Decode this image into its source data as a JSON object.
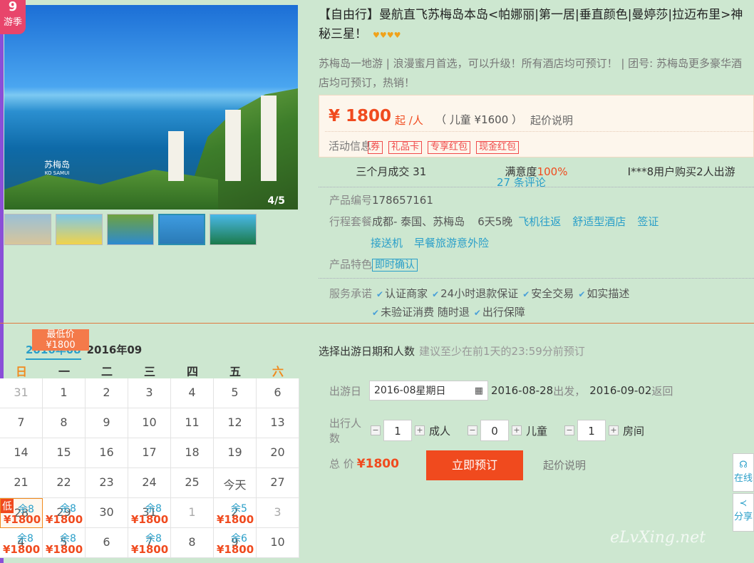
{
  "badge": {
    "top": "9",
    "bottom": "游季"
  },
  "gallery": {
    "location": "苏梅岛",
    "location_sub": "KO SAMUI",
    "counter": "4/5",
    "thumbs": [
      "thumb-1",
      "thumb-2",
      "thumb-3",
      "thumb-4",
      "thumb-5"
    ],
    "active_thumb": 4
  },
  "product": {
    "title": "【自由行】曼航直飞苏梅岛本岛<帕娜丽|第一居|垂直颜色|曼婷莎|拉迈布里>神秘三星！",
    "stars": "♥♥♥♥",
    "subtitle": "苏梅岛一地游 | 浪漫蜜月首选，可以升级！所有酒店均可预订！ | 团号: 苏梅岛更多豪华酒店均可预订，热销！"
  },
  "price": {
    "amount": "¥ 1800",
    "unit": "起 /人",
    "child": "（ 儿童 ¥1600 ）",
    "explain": "起价说明",
    "activity_label": "活动信息",
    "activity_tags": [
      "券",
      "礼品卡",
      "专享红包",
      "现金红包"
    ]
  },
  "stats": {
    "sales": "三个月成交 31",
    "satisfaction_label": "满意度",
    "satisfaction_value": "100%",
    "reviews": "27 条评论",
    "recent": "I***8用户购买2人出游"
  },
  "info": {
    "code_label": "产品编号",
    "code_value": "178657161",
    "plan_label": "行程套餐",
    "plan_route": "成都- 泰国、苏梅岛",
    "plan_days": "6天5晚",
    "plan_tags": [
      "飞机往返",
      "舒适型酒店",
      "签证",
      "接送机",
      "早餐旅游意外险"
    ],
    "feature_label": "产品特色",
    "feature_tag": "即时确认",
    "service_label": "服务承诺",
    "services": [
      "认证商家",
      "24小时退款保证",
      "安全交易",
      "如实描述",
      "未验证消费 随时退",
      "出行保障"
    ]
  },
  "calendar": {
    "lowest_label": "最低价",
    "lowest_price": "¥1800",
    "month_current": "2016年08",
    "month_next": "2016年09",
    "weekdays": [
      "日",
      "一",
      "二",
      "三",
      "四",
      "五",
      "六"
    ],
    "days": [
      {
        "d": "31",
        "muted": true
      },
      {
        "d": "1"
      },
      {
        "d": "2"
      },
      {
        "d": "3"
      },
      {
        "d": "4"
      },
      {
        "d": "5"
      },
      {
        "d": "6"
      },
      {
        "d": "7"
      },
      {
        "d": "8"
      },
      {
        "d": "9"
      },
      {
        "d": "10"
      },
      {
        "d": "11"
      },
      {
        "d": "12"
      },
      {
        "d": "13"
      },
      {
        "d": "14"
      },
      {
        "d": "15"
      },
      {
        "d": "16"
      },
      {
        "d": "17"
      },
      {
        "d": "18"
      },
      {
        "d": "19"
      },
      {
        "d": "20"
      },
      {
        "d": "21"
      },
      {
        "d": "22"
      },
      {
        "d": "23"
      },
      {
        "d": "24"
      },
      {
        "d": "25"
      },
      {
        "d": "今天"
      },
      {
        "d": "27"
      },
      {
        "d": "28",
        "rem": "余8",
        "price": "¥1800",
        "selected": true,
        "low": "低"
      },
      {
        "d": "29",
        "rem": "余8",
        "price": "¥1800"
      },
      {
        "d": "30"
      },
      {
        "d": "31",
        "rem": "余8",
        "price": "¥1800"
      },
      {
        "d": "1",
        "muted": true
      },
      {
        "d": "2",
        "rem": "余5",
        "price": "¥1800"
      },
      {
        "d": "3",
        "muted": true
      },
      {
        "d": "4",
        "rem": "余8",
        "price": "¥1800"
      },
      {
        "d": "5",
        "rem": "余8",
        "price": "¥1800"
      },
      {
        "d": "6"
      },
      {
        "d": "7",
        "rem": "余8",
        "price": "¥1800"
      },
      {
        "d": "8"
      },
      {
        "d": "9",
        "rem": "余6",
        "price": "¥1800"
      },
      {
        "d": "10"
      }
    ]
  },
  "booking": {
    "title": "选择出游日期和人数",
    "hint": "建议至少在前1天的23:59分前预订",
    "date_label": "出游日",
    "date_value": "2016-08",
    "date_weekday": "星期日",
    "depart": "2016-08-28",
    "depart_text": "出发，",
    "return": "2016-09-02",
    "return_text": "返回",
    "people_label": "出行人数",
    "adults": "1",
    "adults_label": "成人",
    "children": "0",
    "children_label": "儿童",
    "rooms": "1",
    "rooms_label": "房间",
    "total_label": "总  价",
    "total": "¥1800",
    "book_button": "立即预订",
    "explain": "起价说明"
  },
  "side": {
    "online": "在线",
    "share": "分享"
  },
  "watermark": "eLvXing.net"
}
